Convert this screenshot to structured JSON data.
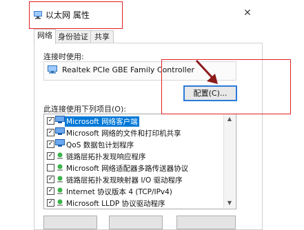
{
  "window": {
    "title": "以太网 属性",
    "close_glyph": "✕"
  },
  "tabs": [
    {
      "label": "网络"
    },
    {
      "label": "身份验证"
    },
    {
      "label": "共享"
    }
  ],
  "connect_using": {
    "label": "连接时使用:",
    "adapter": "Realtek PCIe GBE Family Controller",
    "configure_button": "配置(C)..."
  },
  "items_section": {
    "label": "此连接使用下列项目(O):",
    "items": [
      {
        "label": "Microsoft 网络客户端",
        "checked": true,
        "selected": true,
        "icon": "network-client-icon"
      },
      {
        "label": "Microsoft 网络的文件和打印机共享",
        "checked": true,
        "selected": false,
        "icon": "file-printer-sharing-icon"
      },
      {
        "label": "QoS 数据包计划程序",
        "checked": true,
        "selected": false,
        "icon": "qos-scheduler-icon"
      },
      {
        "label": "链路层拓扑发现响应程序",
        "checked": true,
        "selected": false,
        "icon": "protocol-icon"
      },
      {
        "label": "Microsoft 网络适配器多路传送器协议",
        "checked": false,
        "selected": false,
        "icon": "protocol-icon"
      },
      {
        "label": "链路层拓扑发现映射器 I/O 驱动程序",
        "checked": true,
        "selected": false,
        "icon": "protocol-icon"
      },
      {
        "label": "Internet 协议版本 4 (TCP/IPv4)",
        "checked": true,
        "selected": false,
        "icon": "protocol-icon"
      },
      {
        "label": "Microsoft LLDP 协议驱动程序",
        "checked": true,
        "selected": false,
        "icon": "protocol-icon"
      }
    ]
  },
  "scrollbar": {
    "up": "▲",
    "down": "▼"
  },
  "colors": {
    "annotation_red": "#e02020",
    "annotation_arrow": "#8b1a1a",
    "selection_blue": "#0078d7",
    "focus_blue": "#2b7ad8"
  }
}
